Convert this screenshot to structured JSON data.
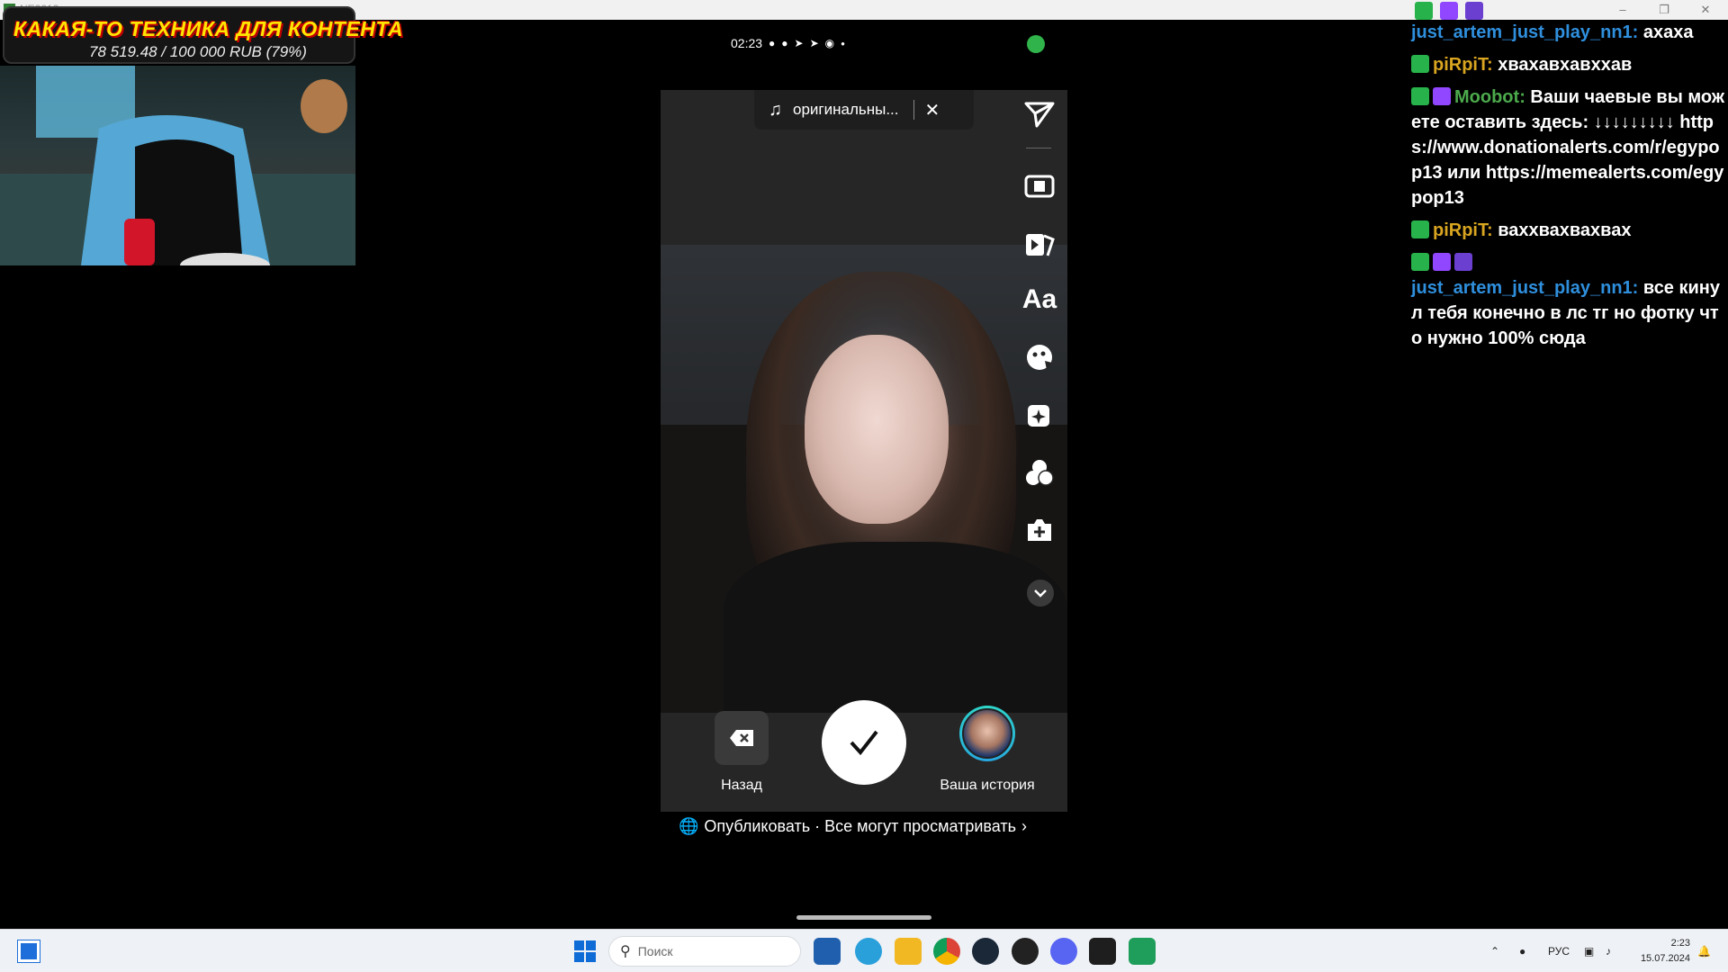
{
  "window": {
    "title": "NE2213"
  },
  "overlay": {
    "goal_title": "КАКАЯ-ТО ТЕХНИКА ДЛЯ КОНТЕНТА",
    "goal_amount": "78 519.48 / 100 000 RUB (79%)"
  },
  "phone_status": {
    "time": "02:23"
  },
  "editor": {
    "music_label": "оригинальны...",
    "tool_text_label": "Aa",
    "back_label": "Назад",
    "story_label": "Ваша история",
    "publish_text": "Опубликовать · Все могут просматривать"
  },
  "chat": {
    "messages": [
      {
        "user": "just_artem_just_play_nn1:",
        "text": "ахаха"
      },
      {
        "user": "piRpiT:",
        "text": "хвахавхавххав"
      },
      {
        "user": "Moobot:",
        "text": "Ваши чаевые вы можете оставить здесь: ↓↓↓↓↓↓↓↓↓ https://www.donationalerts.com/r/egypop13 или https://memealerts.com/egypop13"
      },
      {
        "user": "piRpiT:",
        "text": "ваххвахвахвах"
      },
      {
        "user": "just_artem_just_play_nn1:",
        "text": "все кинул тебя конечно в лс тг но фотку что нужно 100% сюда"
      }
    ]
  },
  "taskbar": {
    "search_placeholder": "Поиск",
    "language": "РУС",
    "time": "2:23",
    "date": "15.07.2024"
  }
}
